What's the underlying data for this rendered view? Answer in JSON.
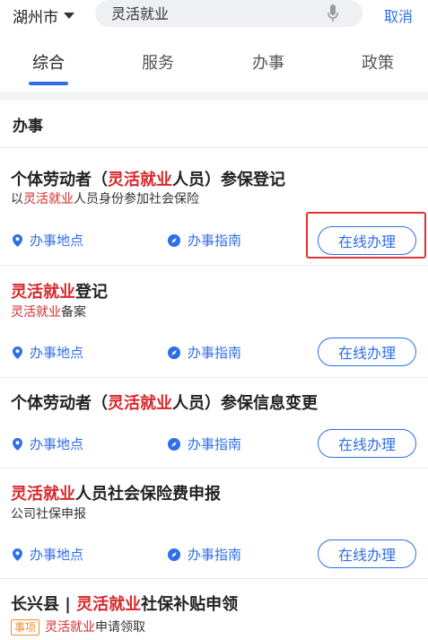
{
  "header": {
    "city": "湖州市",
    "search_value": "灵活就业",
    "cancel": "取消"
  },
  "tabs": [
    {
      "label": "综合",
      "active": true
    },
    {
      "label": "服务",
      "active": false
    },
    {
      "label": "办事",
      "active": false
    },
    {
      "label": "政策",
      "active": false
    }
  ],
  "section_title": "办事",
  "actions": {
    "location": "办事地点",
    "guide": "办事指南",
    "online": "在线办理"
  },
  "items": [
    {
      "title_pre": "个体劳动者（",
      "title_hl": "灵活就业",
      "title_post": "人员）参保登记",
      "sub_pre": "以",
      "sub_hl": "灵活就业",
      "sub_post": "人员身份参加社会保险"
    },
    {
      "title_pre": "",
      "title_hl": "灵活就业",
      "title_post": "登记",
      "sub_pre": "",
      "sub_hl": "灵活就业",
      "sub_post": "备案"
    },
    {
      "title_pre": "个体劳动者（",
      "title_hl": "灵活就业",
      "title_post": "人员）参保信息变更"
    },
    {
      "title_pre": "",
      "title_hl": "灵活就业",
      "title_post": "人员社会保险费申报",
      "sub": "公司社保申报"
    },
    {
      "title_pre": "长兴县 | ",
      "title_hl": "灵活就业",
      "title_post": "社保补贴申领",
      "tag": "事项",
      "sub_hl": "灵活就业",
      "sub_post": "申请领取"
    }
  ],
  "colors": {
    "accent": "#2f6ee8",
    "highlight": "#d8272b",
    "annotation_box": "#e53131",
    "tag": "#f08c2d"
  }
}
